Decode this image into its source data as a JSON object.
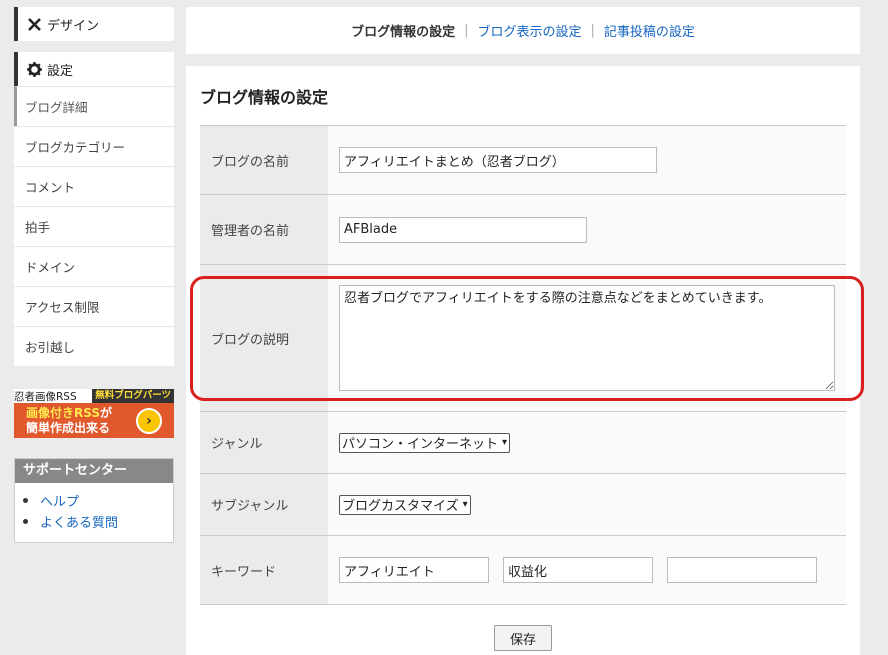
{
  "sidebar": {
    "design_label": "デザイン",
    "settings_label": "設定",
    "items": [
      {
        "label": "ブログ詳細"
      },
      {
        "label": "ブログカテゴリー"
      },
      {
        "label": "コメント"
      },
      {
        "label": "拍手"
      },
      {
        "label": "ドメイン"
      },
      {
        "label": "アクセス制限"
      },
      {
        "label": "お引越し"
      }
    ],
    "banner": {
      "brand": "忍者画像RSS",
      "badge": "無料ブログパーツ",
      "line1_hl": "画像付きRSS",
      "line1_rest": "が",
      "line2": "簡単作成出来る"
    },
    "support": {
      "title": "サポートセンター",
      "links": [
        {
          "label": "ヘルプ"
        },
        {
          "label": "よくある質問"
        }
      ]
    }
  },
  "topnav": {
    "current": "ブログ情報の設定",
    "link1": "ブログ表示の設定",
    "link2": "記事投稿の設定"
  },
  "main": {
    "title": "ブログ情報の設定",
    "fields": {
      "blog_name": {
        "label": "ブログの名前",
        "value": "アフィリエイトまとめ（忍者ブログ）"
      },
      "admin_name": {
        "label": "管理者の名前",
        "value": "AFBlade"
      },
      "description": {
        "label": "ブログの説明",
        "value": "忍者ブログでアフィリエイトをする際の注意点などをまとめていきます。"
      },
      "genre": {
        "label": "ジャンル",
        "value": "パソコン・インターネット"
      },
      "subgenre": {
        "label": "サブジャンル",
        "value": "ブログカスタマイズ"
      },
      "keywords": {
        "label": "キーワード",
        "values": [
          "アフィリエイト",
          "収益化",
          ""
        ]
      }
    },
    "save_label": "保存"
  },
  "colors": {
    "link": "#1565c0",
    "highlight": "#d9201f"
  }
}
